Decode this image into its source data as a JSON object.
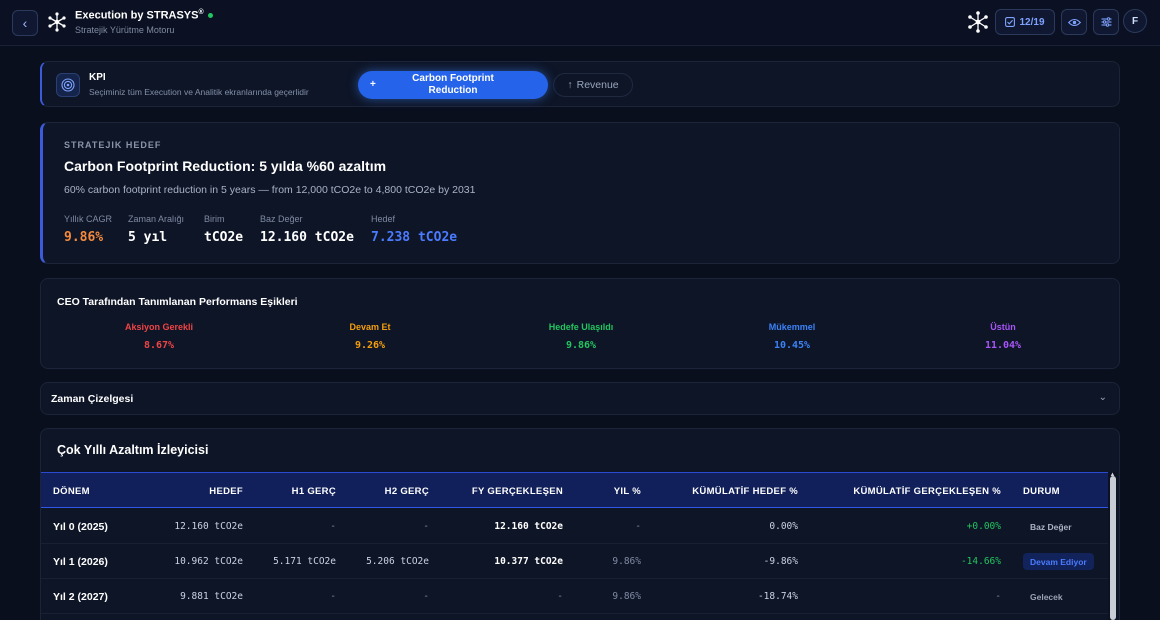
{
  "header": {
    "title": "Execution by STRASYS",
    "title_mark": "®",
    "subtitle": "Stratejik Yürütme Motoru",
    "counter": "12/19",
    "avatar_initial": "F"
  },
  "kpi_selector": {
    "label": "KPI",
    "hint": "Seçiminiz tüm Execution ve Analitik ekranlarında geçerlidir",
    "active_option": "Carbon Footprint Reduction",
    "active_prefix": "+",
    "other_option": "Revenue",
    "other_prefix": "↑"
  },
  "strategic_goal": {
    "kicker": "STRATEJIK HEDEF",
    "title": "Carbon Footprint Reduction: 5 yılda %60 azaltım",
    "description": "60% carbon footprint reduction in 5 years — from 12,000 tCO2e to 4,800 tCO2e by 2031",
    "metrics": [
      {
        "label": "Yıllık CAGR",
        "value": "9.86%"
      },
      {
        "label": "Zaman Aralığı",
        "value": "5 yıl"
      },
      {
        "label": "Birim",
        "value": "tCO2e"
      },
      {
        "label": "Baz Değer",
        "value": "12.160 tCO2e"
      },
      {
        "label": "Hedef",
        "value": "7.238 tCO2e"
      }
    ]
  },
  "thresholds": {
    "title": "CEO Tarafından Tanımlanan Performans Eşikleri",
    "items": [
      {
        "name": "Aksiyon Gerekli",
        "value": "8.67%",
        "color": "#ef4444"
      },
      {
        "name": "Devam Et",
        "value": "9.26%",
        "color": "#f59e0b"
      },
      {
        "name": "Hedefe Ulaşıldı",
        "value": "9.86%",
        "color": "#22c55e"
      },
      {
        "name": "Mükemmel",
        "value": "10.45%",
        "color": "#3b82f6"
      },
      {
        "name": "Üstün",
        "value": "11.04%",
        "color": "#a855f7"
      }
    ]
  },
  "timeline": {
    "title": "Zaman Çizelgesi"
  },
  "tracker": {
    "title": "Çok Yıllı Azaltım İzleyicisi",
    "columns": [
      "DÖNEM",
      "HEDEF",
      "H1 GERÇ",
      "H2 GERÇ",
      "FY GERÇEKLEŞEN",
      "YIL %",
      "KÜMÜLATİF HEDEF %",
      "KÜMÜLATİF GERÇEKLEŞEN %",
      "DURUM"
    ],
    "rows": [
      {
        "period": "Yıl 0 (2025)",
        "target": "12.160 tCO2e",
        "h1": "-",
        "h2": "-",
        "fy": "12.160 tCO2e",
        "yoy": "-",
        "cum_target": "0.00%",
        "cum_actual": "+0.00%",
        "status": "Baz Değer"
      },
      {
        "period": "Yıl 1 (2026)",
        "target": "10.962 tCO2e",
        "h1": "5.171 tCO2e",
        "h2": "5.206 tCO2e",
        "fy": "10.377 tCO2e",
        "yoy": "9.86%",
        "cum_target": "-9.86%",
        "cum_actual": "-14.66%",
        "status": "Devam Ediyor"
      },
      {
        "period": "Yıl 2 (2027)",
        "target": "9.881 tCO2e",
        "h1": "-",
        "h2": "-",
        "fy": "-",
        "yoy": "9.86%",
        "cum_target": "-18.74%",
        "cum_actual": "-",
        "status": "Gelecek"
      }
    ]
  }
}
